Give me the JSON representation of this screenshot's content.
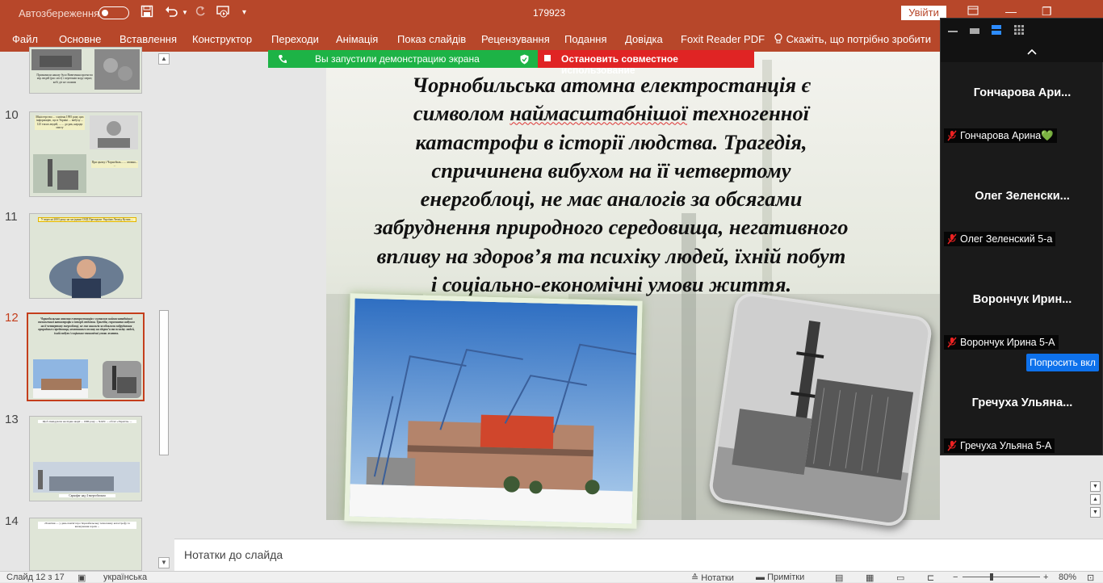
{
  "titlebar": {
    "autosave_label": "Автозбереження",
    "document_title": "179923",
    "signin_label": "Увійти"
  },
  "ribbon": {
    "tabs": [
      "Файл",
      "Основне",
      "Вставлення",
      "Конструктор",
      "Переходи",
      "Анімація",
      "Показ слайдів",
      "Рецензування",
      "Подання",
      "Довідка",
      "Foxit Reader PDF",
      "Скажіть, що потрібно зробити"
    ]
  },
  "share_banner": {
    "sharing_label": "Вы запустили демонстрацию экрана",
    "stop_label": "Остановить совместное использование"
  },
  "thumbnails": {
    "numbers": [
      "10",
      "11",
      "12",
      "13",
      "14"
    ],
    "active": "12",
    "t9_text": "Призначили наказу було Вивезення протягом мір людей (рис міст) і перетинів мору мерит, кобі діт не спамим",
    "t10_text": "Міністерство ... з квітня 1995 року цих інформацію, що в Україні ... вибуху ... 125 тисяч людей, ... ... до рак, народи мисту",
    "t10_text_b": "При цьому і Чорнобиль... ... атомна... ...",
    "t11_text": "У вересні 2003 року на засіданні СНД Президент України Леонід Кучма ...",
    "t12_text": "Чорнобильська атомна електростанція є символом наймасштабнішої техногенної катастрофи в історії людства. Трагедія, спричинена вибухом на її четвертому енергоблоці, не має аналогів за обсягами забруднення природного середовища, негативного впливу на здоров’я та психіку людей, їхній побут і соціально-економічні умови життя.",
    "t13_text": "Щоб ліквідувати наслідки аварії ... 1986 року ... ЧАЕС ... об'єкт «Укриття» ...",
    "t13_caption": "Саркофаг над 4 енергоблоком",
    "t14_text": "26 квітня — у день пам'яті про Чорнобильську техногенну катастрофу та вшанування героїв ..."
  },
  "slide": {
    "line1": "Чорнобильська атомна електростанція є",
    "line2a": "символом ",
    "line2u": "наймасштабнішої",
    "line2b": " техногенної",
    "line3": "катастрофи в історії людства. Трагедія,",
    "line4": "спричинена вибухом на її четвертому",
    "line5": "енергоблоці, не має аналогів за обсягами",
    "line6": "забруднення природного середовища, негативного",
    "line7": "впливу на здоров’я та психіку людей, їхній побут",
    "line8": "і соціально-економічні умови життя."
  },
  "notes": {
    "placeholder": "Нотатки до слайда"
  },
  "statusbar": {
    "slide_counter": "Слайд 12 з 17",
    "language": "українська",
    "notes_label": "Нотатки",
    "comments_label": "Примітки",
    "zoom_level": "80%"
  },
  "zoom_panel": {
    "participants": [
      {
        "short_name": "Гончарова  Ари...",
        "full_name": "Гончарова Арина💚"
      },
      {
        "short_name": "Олег  Зеленски...",
        "full_name": "Олег Зеленский 5-а"
      },
      {
        "short_name": "Ворончук  Ирин...",
        "full_name": "Ворончук Ирина 5-А"
      },
      {
        "short_name": "Гречуха  Ульяна...",
        "full_name": "Гречуха Ульяна 5-А"
      }
    ],
    "ask_button_label": "Попросить вкл"
  },
  "colors": {
    "accent": "#b7472a",
    "active_thumb": "#c43e1c",
    "share_green": "#1db346",
    "share_red": "#e02424",
    "zoom_blue": "#0e71eb"
  }
}
